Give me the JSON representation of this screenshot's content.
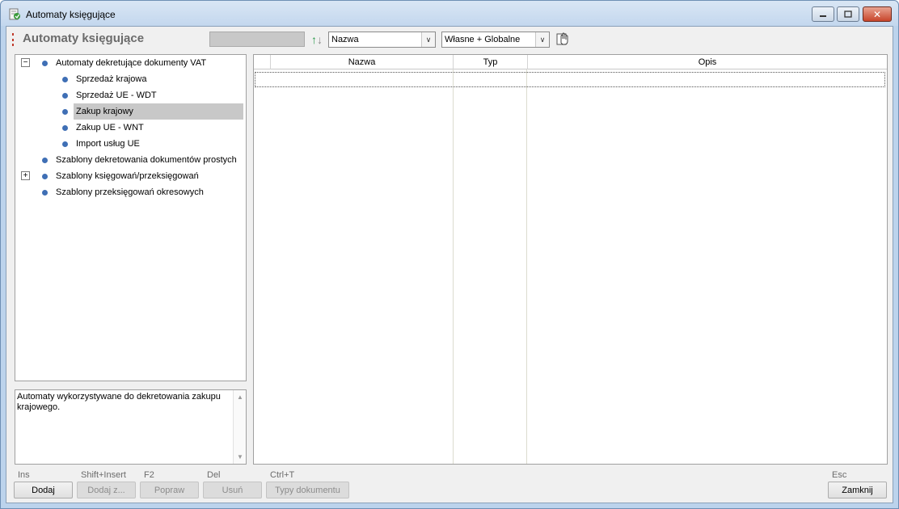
{
  "window": {
    "title": "Automaty księgujące",
    "minimize_label": "—",
    "maximize_label": "▭",
    "close_label": "✕"
  },
  "toolbar": {
    "title": "Automaty księgujące",
    "sort_field": "Nazwa",
    "scope_filter": "Własne + Globalne"
  },
  "tree": {
    "items": [
      {
        "label": "Automaty dekretujące dokumenty VAT",
        "expander": "−"
      },
      {
        "label": "Sprzedaż krajowa"
      },
      {
        "label": "Sprzedaż UE - WDT"
      },
      {
        "label": "Zakup krajowy",
        "selected": true
      },
      {
        "label": "Zakup UE - WNT"
      },
      {
        "label": "Import usług UE"
      },
      {
        "label": "Szablony dekretowania dokumentów prostych"
      },
      {
        "label": "Szablony księgowań/przeksięgowań",
        "expander": "+"
      },
      {
        "label": "Szablony przeksięgowań okresowych"
      }
    ]
  },
  "description": {
    "text": "Automaty wykorzystywane do dekretowania zakupu krajowego."
  },
  "grid": {
    "columns": [
      "Nazwa",
      "Typ",
      "Opis"
    ],
    "rows": []
  },
  "buttons": {
    "add": {
      "hint": "Ins",
      "label": "Dodaj"
    },
    "add_from": {
      "hint": "Shift+Insert",
      "label": "Dodaj z..."
    },
    "edit": {
      "hint": "F2",
      "label": "Popraw"
    },
    "delete": {
      "hint": "Del",
      "label": "Usuń"
    },
    "doc_types": {
      "hint": "Ctrl+T",
      "label": "Typy dokumentu"
    },
    "close": {
      "hint": "Esc",
      "label": "Zamknij"
    }
  },
  "colors": {
    "selection": "#c8c8c8",
    "bullet": "#3f6fb5",
    "title_gray": "#6b6b6b"
  }
}
